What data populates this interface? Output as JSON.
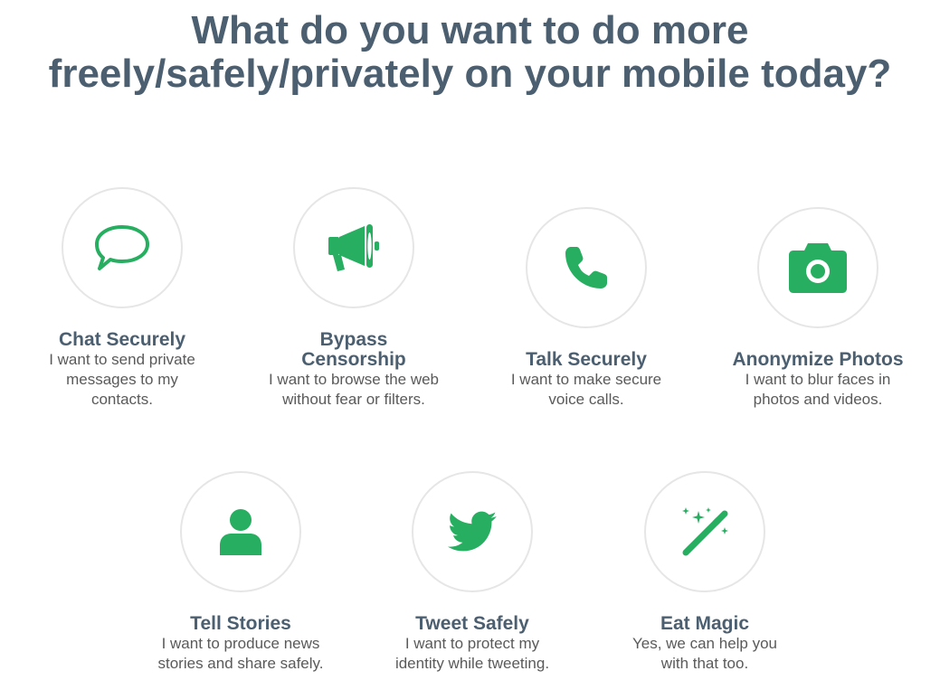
{
  "page": {
    "headline_line1": "What do you want to do more",
    "headline_line2": "freely/safely/privately on your mobile today?"
  },
  "colors": {
    "accent": "#27ae60",
    "heading": "#4b5f70",
    "body_text": "#5a5a5a",
    "circle_border": "#e6e6e6"
  },
  "options": [
    {
      "icon": "speech-bubble-icon",
      "title": "Chat Securely",
      "description": "I want to send private messages to my contacts."
    },
    {
      "icon": "megaphone-icon",
      "title": "Bypass Censorship",
      "description": "I want to browse the web without fear or filters."
    },
    {
      "icon": "phone-icon",
      "title": "Talk Securely",
      "description": "I want to make secure voice calls."
    },
    {
      "icon": "camera-icon",
      "title": "Anonymize Photos",
      "description": "I want to blur faces in photos and videos."
    },
    {
      "icon": "user-icon",
      "title": "Tell Stories",
      "description": "I want to produce news stories and share safely."
    },
    {
      "icon": "twitter-bird-icon",
      "title": "Tweet Safely",
      "description": "I want to protect my identity while tweeting."
    },
    {
      "icon": "magic-wand-icon",
      "title": "Eat Magic",
      "description": "Yes, we can help you with that too."
    }
  ]
}
